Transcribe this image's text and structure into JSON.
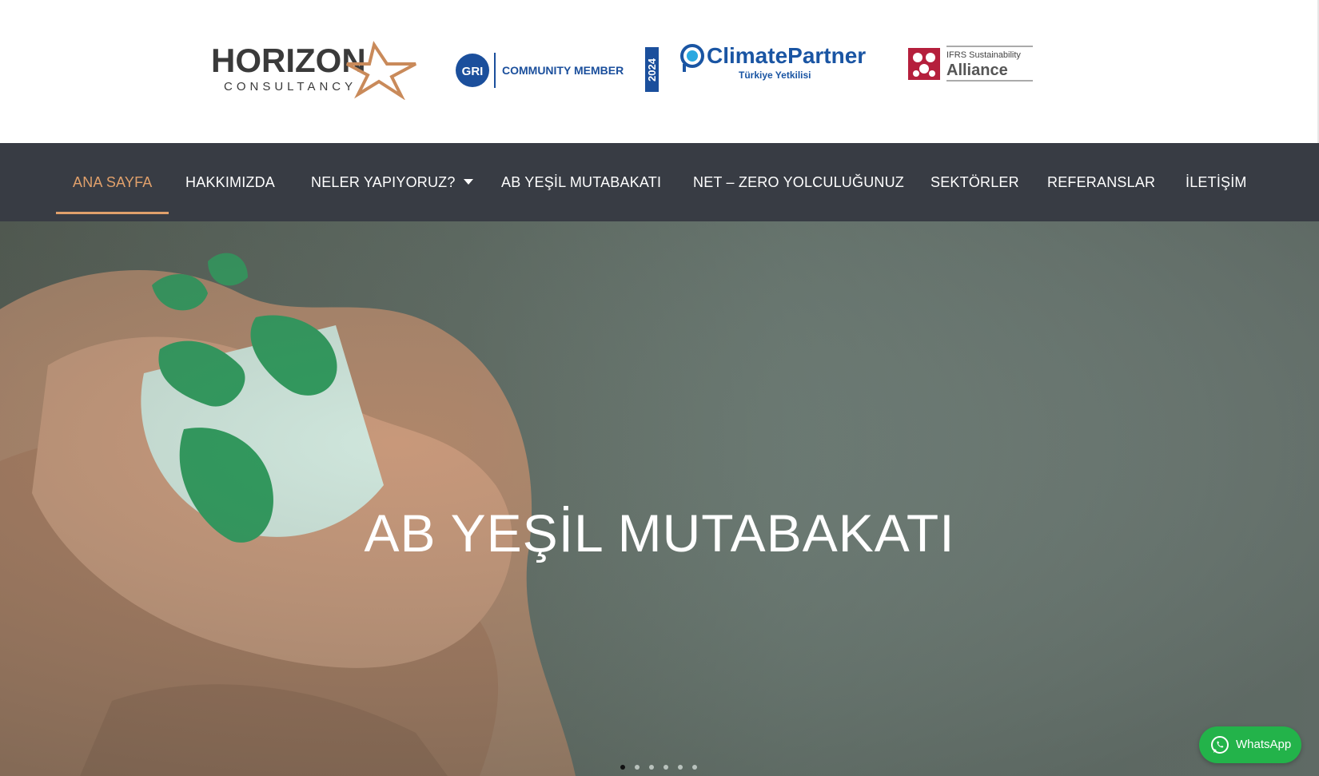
{
  "logos": {
    "horizon": {
      "name": "HORIZON",
      "tagline": "CONSULTANCY"
    },
    "gri": {
      "mark": "GRI",
      "label": "COMMUNITY MEMBER",
      "year": "2024"
    },
    "climatepartner": {
      "name": "ClimatePartner",
      "subtitle": "Türkiye Yetkilisi"
    },
    "ifrs": {
      "top": "IFRS Sustainability",
      "bottom": "Alliance"
    }
  },
  "nav": {
    "items": [
      {
        "label": "ANA SAYFA",
        "active": true
      },
      {
        "label": "HAKKIMIZDA"
      },
      {
        "label": "NELER YAPIYORUZ?",
        "has_dropdown": true
      },
      {
        "label": "AB YEŞİL MUTABAKATI"
      },
      {
        "label": "NET – ZERO YOLCULUĞUNUZ"
      },
      {
        "label": "SEKTÖRLER"
      },
      {
        "label": "REFERANSLAR"
      },
      {
        "label": "İLETİŞİM"
      }
    ]
  },
  "hero": {
    "title": "AB YEŞİL MUTABAKATI",
    "slides_total": 6,
    "active_slide": 1
  },
  "whatsapp": {
    "label": "WhatsApp"
  },
  "colors": {
    "nav_bg": "#383c44",
    "accent": "#e0a06b",
    "gri_blue": "#1b4f9c",
    "cp_blue": "#1a55a3",
    "ifrs_red": "#b51f3c",
    "whatsapp_green": "#23b34a"
  }
}
